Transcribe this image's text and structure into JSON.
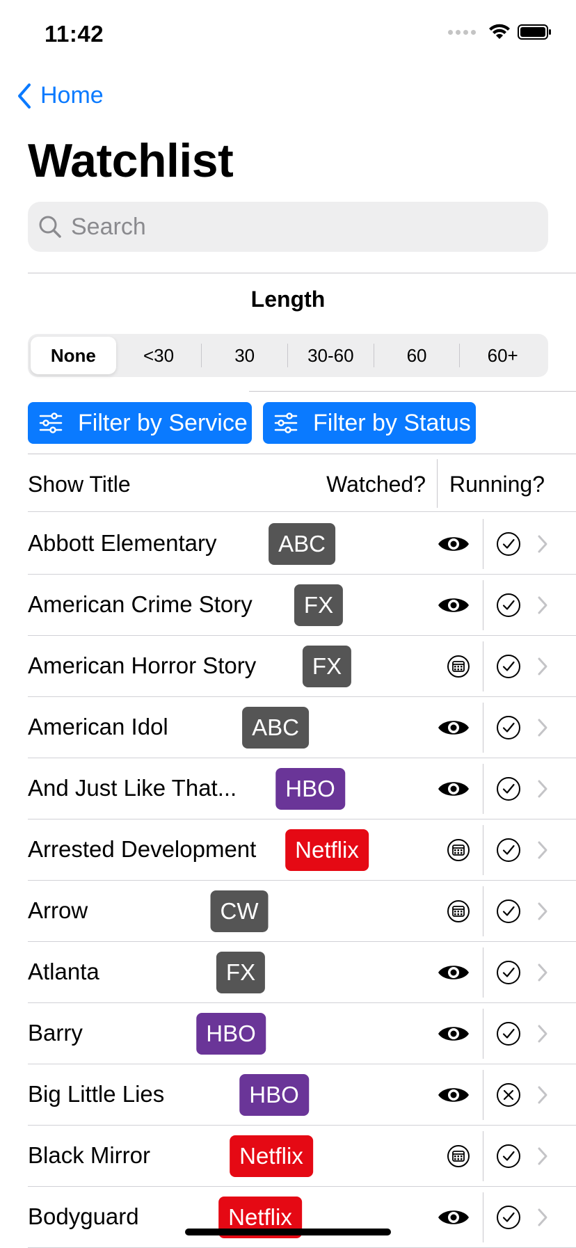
{
  "status_bar": {
    "time": "11:42"
  },
  "nav": {
    "back_label": "Home",
    "title": "Watchlist"
  },
  "search": {
    "placeholder": "Search"
  },
  "length": {
    "label": "Length",
    "options": [
      "None",
      "<30",
      "30",
      "30-60",
      "60",
      "60+"
    ],
    "selected": "None"
  },
  "filters": {
    "service_label": "Filter by Service",
    "status_label": "Filter by Status"
  },
  "table": {
    "headers": {
      "title": "Show Title",
      "watched": "Watched?",
      "running": "Running?"
    },
    "rows": [
      {
        "title": "Abbott Elementary",
        "service": "ABC",
        "watched": "eye",
        "running": "check"
      },
      {
        "title": "American Crime Story",
        "service": "FX",
        "watched": "eye",
        "running": "check"
      },
      {
        "title": "American Horror Story",
        "service": "FX",
        "watched": "calendar",
        "running": "check"
      },
      {
        "title": "American Idol",
        "service": "ABC",
        "watched": "eye",
        "running": "check"
      },
      {
        "title": "And Just Like That...",
        "service": "HBO",
        "watched": "eye",
        "running": "check"
      },
      {
        "title": "Arrested Development",
        "service": "Netflix",
        "watched": "calendar",
        "running": "check"
      },
      {
        "title": "Arrow",
        "service": "CW",
        "watched": "calendar",
        "running": "check"
      },
      {
        "title": "Atlanta",
        "service": "FX",
        "watched": "eye",
        "running": "check"
      },
      {
        "title": "Barry",
        "service": "HBO",
        "watched": "eye",
        "running": "check"
      },
      {
        "title": "Big Little Lies",
        "service": "HBO",
        "watched": "eye",
        "running": "x"
      },
      {
        "title": "Black Mirror",
        "service": "Netflix",
        "watched": "calendar",
        "running": "check"
      },
      {
        "title": "Bodyguard",
        "service": "Netflix",
        "watched": "eye",
        "running": "check"
      }
    ]
  },
  "colors": {
    "accent": "#0a7aff",
    "badge_gray": "#555555",
    "badge_hbo": "#6a3598",
    "badge_netflix": "#e50914"
  }
}
